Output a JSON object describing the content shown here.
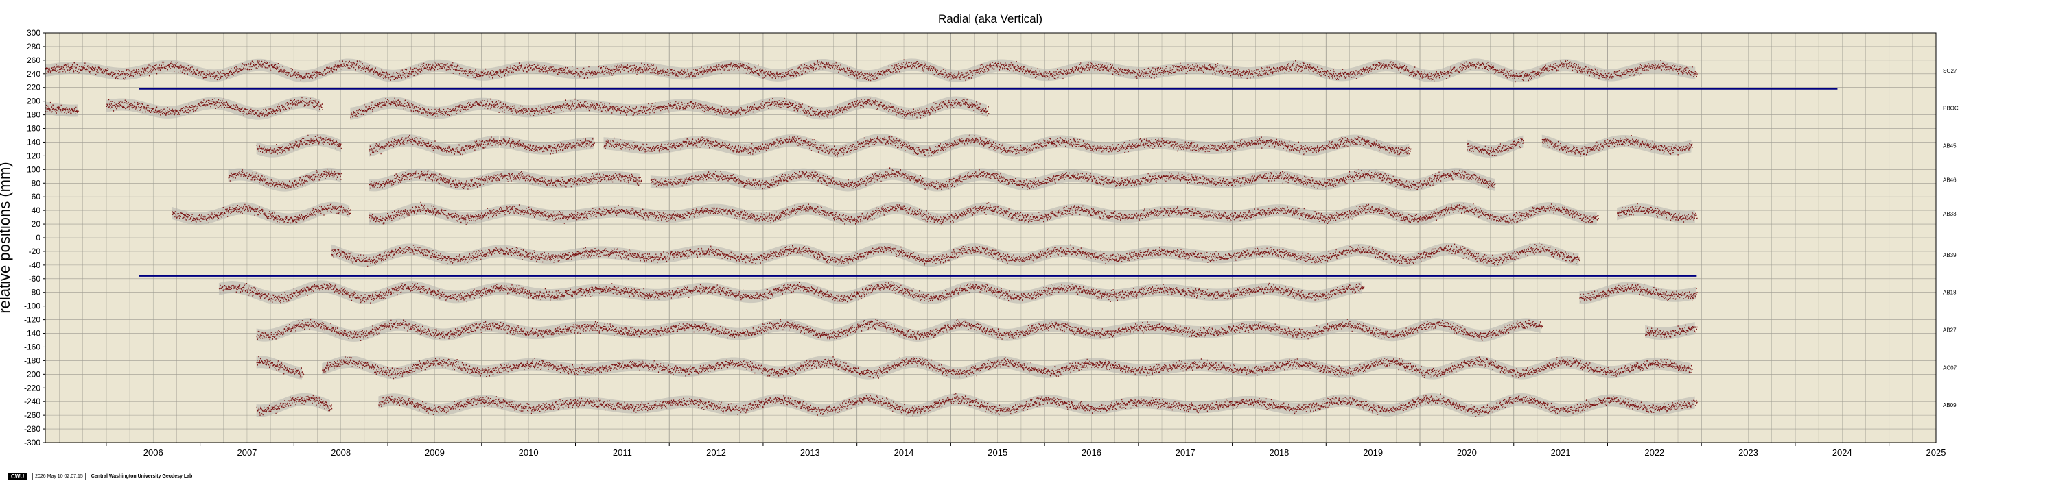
{
  "chart_data": {
    "type": "scatter",
    "title": "Radial (aka Vertical)",
    "ylabel": "relative positions (mm)",
    "xlabel": "",
    "xlim": [
      2005.35,
      2025.5
    ],
    "ylim": [
      -300,
      300
    ],
    "y_ticks": [
      300,
      280,
      260,
      240,
      220,
      200,
      180,
      160,
      140,
      120,
      100,
      80,
      60,
      40,
      20,
      0,
      -20,
      -40,
      -60,
      -80,
      -100,
      -120,
      -140,
      -160,
      -180,
      -200,
      -220,
      -240,
      -260,
      -280,
      -300
    ],
    "y_tick_labels": [
      "300",
      "280",
      "260",
      "240",
      "220",
      "200",
      "180",
      "160",
      "140",
      "120",
      "100",
      "80",
      "60",
      "40",
      "20",
      "0",
      "-20",
      "-40",
      "-60",
      "-80",
      "-100",
      "-120",
      "-140",
      "-160",
      "-180",
      "-200",
      "-220",
      "-240",
      "-260",
      "-280",
      "-300"
    ],
    "x_ticks": [
      2006,
      2007,
      2008,
      2009,
      2010,
      2011,
      2012,
      2013,
      2014,
      2015,
      2016,
      2017,
      2018,
      2019,
      2020,
      2021,
      2022,
      2023,
      2024,
      2025
    ],
    "x_tick_labels": [
      "2006",
      "2007",
      "2008",
      "2009",
      "2010",
      "2011",
      "2012",
      "2013",
      "2014",
      "2015",
      "2016",
      "2017",
      "2018",
      "2019",
      "2020",
      "2021",
      "2022",
      "2023",
      "2024",
      "2025"
    ],
    "grid": true,
    "series": [
      {
        "name": "SG27",
        "offset": 245,
        "segments": [
          [
            2005.35,
            2022.95
          ]
        ]
      },
      {
        "name": "PBOC",
        "offset": 190,
        "segments": [
          [
            2005.35,
            2005.7
          ],
          [
            2006.0,
            2008.3
          ],
          [
            2008.6,
            2015.4
          ]
        ]
      },
      {
        "name": "AB45",
        "offset": 135,
        "segments": [
          [
            2007.6,
            2008.5
          ],
          [
            2008.8,
            2010.2
          ],
          [
            2010.2,
            2011.2
          ],
          [
            2011.3,
            2019.9
          ],
          [
            2020.5,
            2021.1
          ],
          [
            2021.3,
            2022.9
          ]
        ]
      },
      {
        "name": "AB46",
        "offset": 85,
        "segments": [
          [
            2007.3,
            2008.5
          ],
          [
            2008.8,
            2011.7
          ],
          [
            2011.8,
            2020.8
          ]
        ]
      },
      {
        "name": "AB33",
        "offset": 35,
        "segments": [
          [
            2006.7,
            2008.6
          ],
          [
            2008.8,
            2021.9
          ],
          [
            2022.1,
            2022.95
          ]
        ]
      },
      {
        "name": "AB39",
        "offset": -25,
        "segments": [
          [
            2008.4,
            2021.7
          ]
        ]
      },
      {
        "name": "AB18",
        "offset": -80,
        "segments": [
          [
            2007.2,
            2019.4
          ],
          [
            2021.7,
            2022.95
          ]
        ]
      },
      {
        "name": "AB27",
        "offset": -135,
        "segments": [
          [
            2007.6,
            2021.3
          ],
          [
            2022.4,
            2022.95
          ]
        ]
      },
      {
        "name": "AC07",
        "offset": -190,
        "segments": [
          [
            2007.6,
            2008.1
          ],
          [
            2008.3,
            2022.9
          ]
        ]
      },
      {
        "name": "AB09",
        "offset": -245,
        "segments": [
          [
            2007.6,
            2008.4
          ],
          [
            2008.9,
            2022.95
          ]
        ]
      }
    ],
    "reference_lines": [
      {
        "y": 218,
        "x": [
          2006.35,
          2024.45
        ],
        "color": "#000080"
      },
      {
        "y": -56,
        "x": [
          2006.35,
          2022.95
        ],
        "color": "#000080"
      }
    ],
    "colors": {
      "plot_bg": "#ebe6d2",
      "point": "#7a1414",
      "error_band": "#b5b3ad",
      "grid": "#9c9a90",
      "ref_line": "#000080"
    }
  },
  "footer": {
    "logo": "CWU",
    "timestamp": "2026 May 10 02:07:15",
    "org": "Central Washington University Geodesy Lab"
  }
}
